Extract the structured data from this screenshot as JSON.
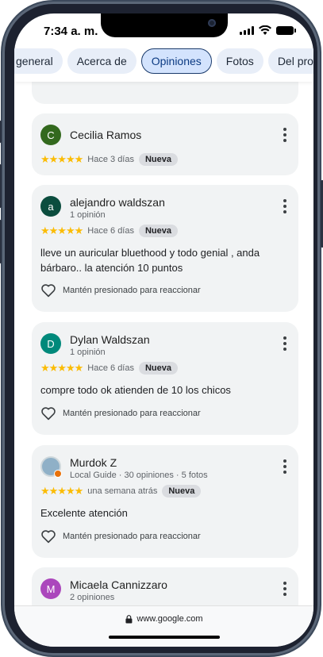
{
  "status": {
    "time": "7:34 a. m."
  },
  "tabs": [
    {
      "label": "general"
    },
    {
      "label": "Acerca de"
    },
    {
      "label": "Opiniones"
    },
    {
      "label": "Fotos"
    },
    {
      "label": "Del prop"
    }
  ],
  "reviews": [
    {
      "initial": "C",
      "avatar_color": "#33691e",
      "name": "Cecilia Ramos",
      "subtitle": "",
      "stars": "★★★★★",
      "time": "Hace 3 días",
      "badge": "Nueva",
      "text": "",
      "react": ""
    },
    {
      "initial": "a",
      "avatar_color": "#0b4d3e",
      "name": "alejandro waldszan",
      "subtitle": "1 opinión",
      "stars": "★★★★★",
      "time": "Hace 6 días",
      "badge": "Nueva",
      "text": "lleve un auricular bluethood y todo genial , anda bárbaro.. la atención 10 puntos",
      "react": "Mantén presionado para reaccionar"
    },
    {
      "initial": "D",
      "avatar_color": "#00897b",
      "name": "Dylan Waldszan",
      "subtitle": "1 opinión",
      "stars": "★★★★★",
      "time": "Hace 6 días",
      "badge": "Nueva",
      "text": "compre todo ok atienden de 10 los chicos",
      "react": "Mantén presionado para reaccionar"
    },
    {
      "initial": "",
      "avatar_color": "#8fb0c7",
      "name": "Murdok Z",
      "subtitle": "Local Guide · 30 opiniones · 5 fotos",
      "stars": "★★★★★",
      "time": "una semana atrás",
      "badge": "Nueva",
      "text": "Excelente atención",
      "react": "Mantén presionado para reaccionar"
    },
    {
      "initial": "M",
      "avatar_color": "#ab47bc",
      "name": "Micaela Cannizzaro",
      "subtitle": "2 opiniones",
      "stars": "",
      "time": "",
      "badge": "",
      "text": "",
      "react": ""
    }
  ],
  "addressbar": {
    "url": "www.google.com"
  }
}
